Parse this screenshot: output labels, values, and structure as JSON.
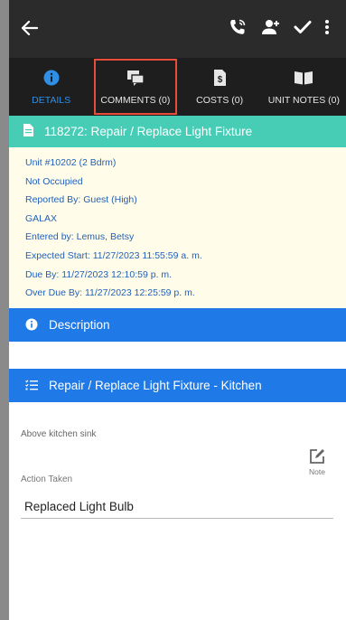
{
  "tabs": [
    {
      "label": "DETAILS",
      "icon": "info-icon",
      "active": true
    },
    {
      "label": "COMMENTS (0)",
      "icon": "comments-icon",
      "active": false
    },
    {
      "label": "COSTS (0)",
      "icon": "costs-icon",
      "active": false
    },
    {
      "label": "UNIT NOTES (0)",
      "icon": "book-icon",
      "active": false
    }
  ],
  "work_order": {
    "title": "118272: Repair / Replace Light Fixture",
    "details": [
      "Unit #10202 (2 Bdrm)",
      "Not Occupied",
      "Reported By: Guest  (High)",
      "GALAX",
      "Entered by: Lemus, Betsy",
      "Expected Start: 11/27/2023 11:55:59 a. m.",
      "Due By: 11/27/2023 12:10:59 p. m.",
      "Over Due By: 11/27/2023 12:25:59 p. m."
    ]
  },
  "description": {
    "title": "Description"
  },
  "task": {
    "title": "Repair / Replace Light Fixture - Kitchen",
    "note_text": "Above kitchen sink",
    "note_button": "Note",
    "action_label": "Action Taken",
    "action_value": "Replaced Light Bulb"
  },
  "colors": {
    "appbar": "#2b2b2b",
    "tabs_bg": "#1e1e1e",
    "active_tab": "#2f8fe6",
    "header_teal": "#47cdb6",
    "section_blue": "#1f7ae7",
    "details_bg": "#fffde9",
    "details_text": "#2260b9",
    "highlight": "#e74c3c"
  }
}
